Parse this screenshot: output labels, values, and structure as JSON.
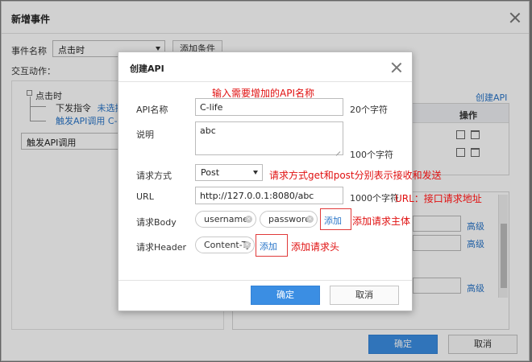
{
  "outer": {
    "title": "新增事件",
    "event_name_label": "事件名称",
    "event_select_value": "点击时",
    "add_condition": "添加条件",
    "interaction_label": "交互动作：",
    "tree_root": "点击时",
    "tree_item1_prefix": "下发指令",
    "tree_item1_link": "未选择",
    "tree_item2": "触发API调用 C-li",
    "action_select_value": "触发API调用",
    "create_api_link": "创建API",
    "col_action": "操作",
    "advanced": "高级",
    "confirm": "确定",
    "cancel": "取消"
  },
  "modal": {
    "title": "创建API",
    "api_name_label": "API名称",
    "api_name_value": "C-life",
    "api_name_hint": "20个字符",
    "desc_label": "说明",
    "desc_value": "abc",
    "desc_hint": "100个字符",
    "method_label": "请求方式",
    "method_value": "Post",
    "url_label": "URL",
    "url_value": "http://127.0.0.1:8080/abc",
    "url_hint": "1000个字符",
    "body_label": "请求Body",
    "body_tags": [
      "username",
      "password"
    ],
    "add_label": "添加",
    "header_label": "请求Header",
    "header_tags": [
      "Content-Ty"
    ],
    "confirm": "确定",
    "cancel": "取消"
  },
  "annotations": {
    "api_name": "输入需要增加的API名称",
    "method": "请求方式get和post分别表示接收和发送",
    "url": "URL：接口请求地址",
    "body": "添加请求主体",
    "header": "添加请求头"
  },
  "colors": {
    "primary": "#3b8ee3",
    "link": "#2a76c9",
    "annotation": "#e01010"
  }
}
